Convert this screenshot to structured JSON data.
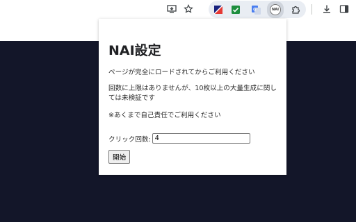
{
  "toolbar": {
    "ext_nai_label": "NAI"
  },
  "popup": {
    "title": "NAI設定",
    "p1": "ページが完全にロードされてからご利用ください",
    "p2": "回数に上限はありませんが、10枚以上の大量生成に関しては未検証です",
    "p3": "※あくまで自己責任でご利用ください",
    "count_label": "クリック回数:",
    "count_value": "4",
    "start_label": "開始"
  },
  "colors": {
    "page_dark": "#131629",
    "ext_green": "#1e8e3e",
    "ext_blue": "#4a7ef0"
  }
}
